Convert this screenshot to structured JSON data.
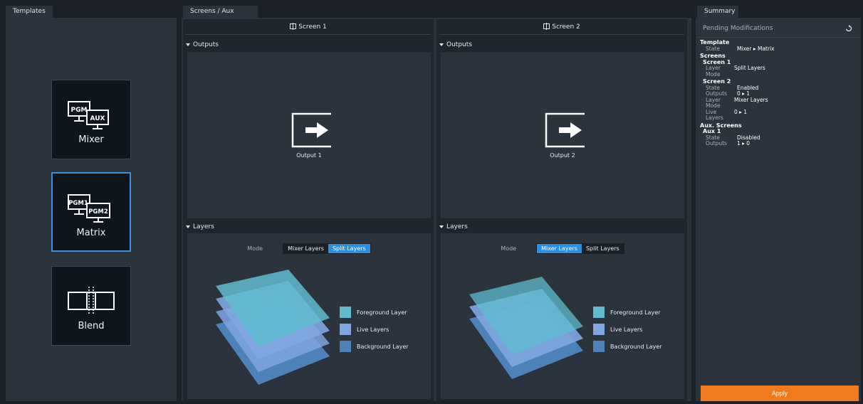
{
  "tabs": {
    "templates": "Templates",
    "screens": "Screens / Aux Screens",
    "summary": "Summary"
  },
  "templates": [
    {
      "name": "Mixer",
      "icon": "mixer-monitors-icon",
      "labels": [
        "PGM",
        "AUX"
      ],
      "selected": false
    },
    {
      "name": "Matrix",
      "icon": "matrix-monitors-icon",
      "labels": [
        "PGM1",
        "PGM2"
      ],
      "selected": true
    },
    {
      "name": "Blend",
      "icon": "blend-screens-icon",
      "labels": [],
      "selected": false
    }
  ],
  "screens": [
    {
      "title": "Screen 1",
      "outputs_header": "Outputs",
      "output_label": "Output 1",
      "layers_header": "Layers",
      "mode_label": "Mode",
      "modes": [
        "Mixer Layers",
        "Split Layers"
      ],
      "active_mode": "Split Layers",
      "legend": [
        "Foreground Layer",
        "Live Layers",
        "Background Layer"
      ]
    },
    {
      "title": "Screen 2",
      "outputs_header": "Outputs",
      "output_label": "Output 2",
      "layers_header": "Layers",
      "mode_label": "Mode",
      "modes": [
        "Mixer Layers",
        "Split Layers"
      ],
      "active_mode": "Mixer Layers",
      "legend": [
        "Foreground Layer",
        "Live Layers",
        "Background Layer"
      ]
    }
  ],
  "summary": {
    "title": "Pending Modifications",
    "template": {
      "section": "Template",
      "state_key": "State",
      "state_val": "Mixer ▸ Matrix"
    },
    "screens_section": "Screens",
    "screen1": {
      "name": "Screen 1",
      "k1": "Layer Mode",
      "v1": "Split Layers"
    },
    "screen2": {
      "name": "Screen 2",
      "k1": "State",
      "v1": "Enabled",
      "k2": "Outputs",
      "v2": "0 ▸ 1",
      "k3": "Layer Mode",
      "v3": "Mixer Layers",
      "k4": "Live Layers",
      "v4": "0 ▸ 1"
    },
    "aux_section": "Aux. Screens",
    "aux1": {
      "name": "Aux 1",
      "k1": "State",
      "v1": "Disabled",
      "k2": "Outputs",
      "v2": "1 ▸ 0"
    },
    "apply_label": "Apply"
  },
  "colors": {
    "accent": "#2d8fe0",
    "apply": "#f07b1e",
    "foreground_layer": "#5fbccf",
    "live_layers": "#7fa6e0",
    "background_layer": "#4d82b8"
  }
}
